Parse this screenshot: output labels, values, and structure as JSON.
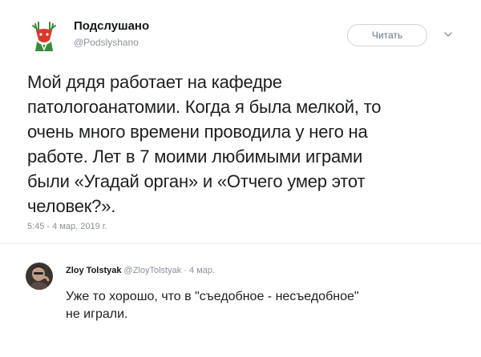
{
  "tweet": {
    "author_name": "Подслушано",
    "author_handle": "@Podslyshano",
    "follow_label": "Читать",
    "text_lines": [
      "Мой дядя работает на кафедре",
      "патологоанатомии. Когда я была мелкой, то",
      "очень много времени проводила у него на",
      "работе. Лет в 7 моими любимыми играми",
      "были «Угадай орган» и «Отчего умер этот",
      "человек?»."
    ],
    "timestamp": "5:45 - 4 мар. 2019 г."
  },
  "reply": {
    "author_name": "Zloy Tolstyak",
    "author_handle": "@ZloyTolstyak",
    "separator": "·",
    "date": "4 мар.",
    "text_lines": [
      "Уже то хорошо, что в \"съедобное - несъедобное\"",
      "не играли."
    ]
  },
  "colors": {
    "text": "#14171a",
    "muted": "#8a9099",
    "border": "#cfd4d9",
    "logo_red": "#d93a2b",
    "logo_green": "#3a8a3a"
  },
  "icons": {
    "main_avatar": "deer-logo-icon",
    "follow_chevron": "chevron-down-icon",
    "reply_avatar": "user-photo-icon"
  }
}
